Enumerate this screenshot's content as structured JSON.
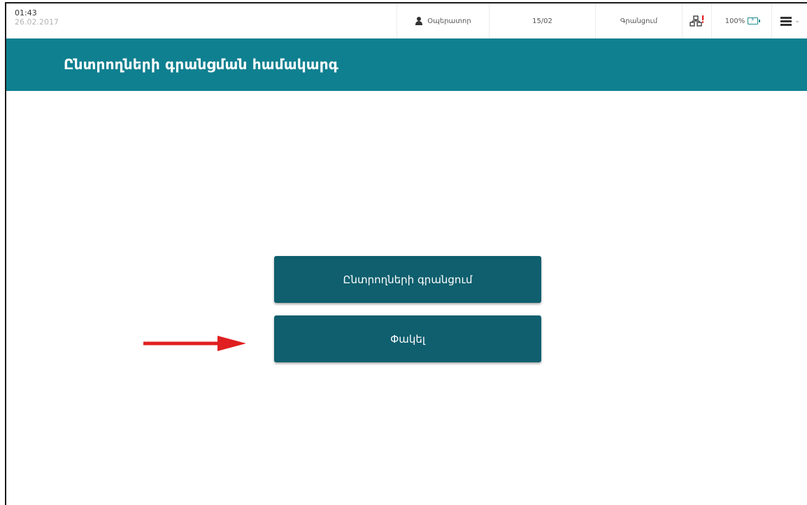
{
  "statusbar": {
    "time": "01:43",
    "date": "26.02.2017",
    "operator_label": "Օպերատոր",
    "count": "15/02",
    "registration_label": "Գրանցում",
    "battery_percent": "100%"
  },
  "header": {
    "title": "Ընտրողների գրանցման համակարգ"
  },
  "buttons": {
    "register_label": "Ընտրողների գրանցում",
    "close_label": "Փակել"
  },
  "colors": {
    "header_bg": "#0f8090",
    "button_bg": "#0f5f6e",
    "arrow": "#e02020",
    "network_alert": "#e02020"
  },
  "icons": {
    "user": "user-icon",
    "network": "network-icon",
    "battery": "battery-charging-icon",
    "menu": "hamburger-menu-icon",
    "menu_chevron": "chevron-down-icon",
    "arrow": "arrow-right-icon"
  }
}
